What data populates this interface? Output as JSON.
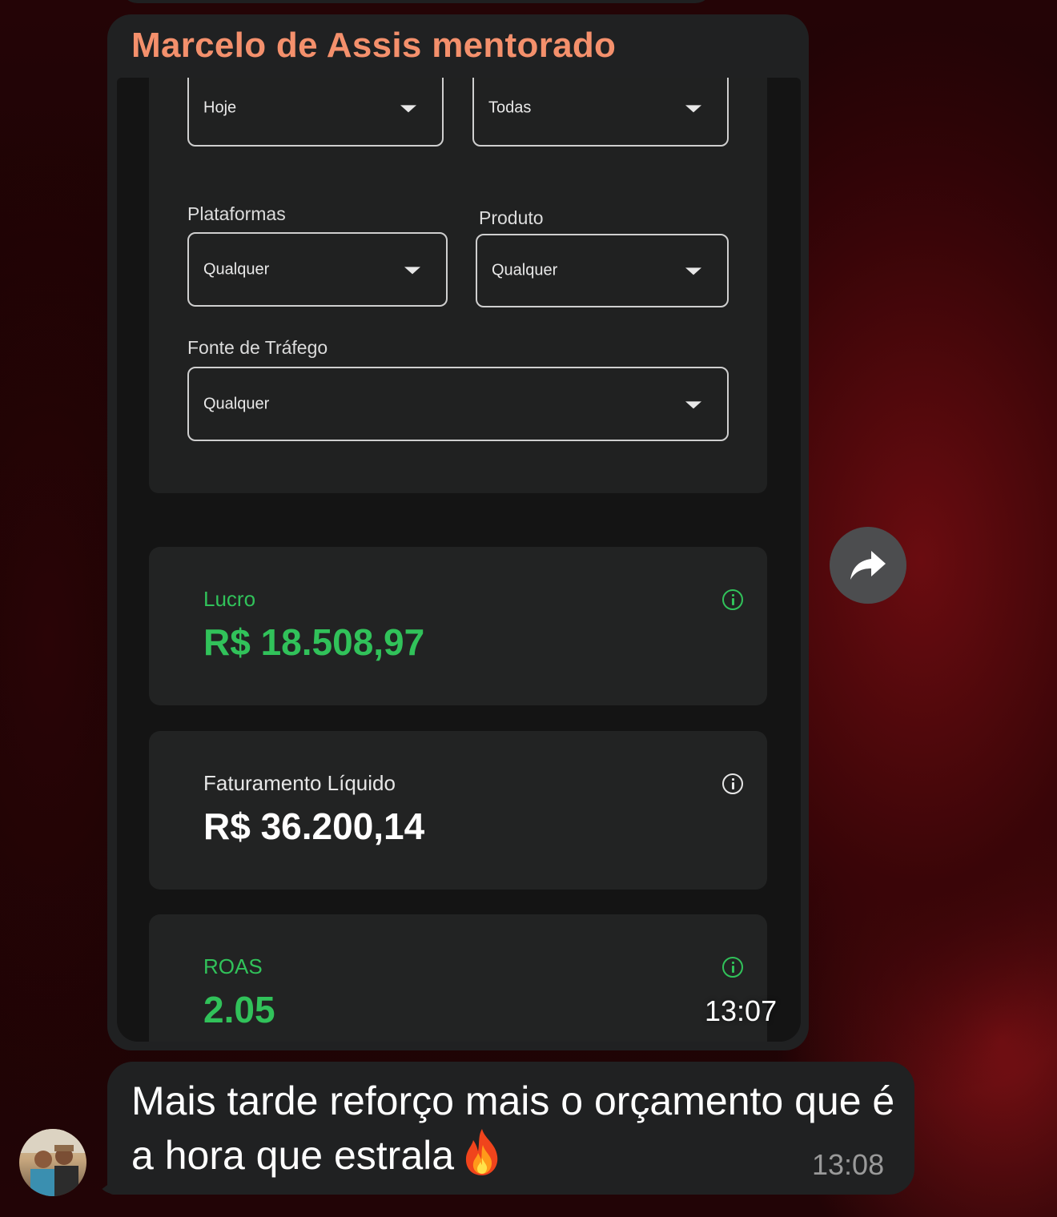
{
  "colors": {
    "sender_name": "#f4906c",
    "accent_green": "#31c25a",
    "bubble_bg": "#202122",
    "card_bg": "#222323"
  },
  "message_1": {
    "sender": "Marcelo de Assis mentorado",
    "time": "13:07",
    "screenshot": {
      "filters": {
        "period": {
          "value": "Hoje"
        },
        "accounts": {
          "value": "Todas"
        },
        "platforms": {
          "label": "Plataformas",
          "value": "Qualquer"
        },
        "product": {
          "label": "Produto",
          "value": "Qualquer"
        },
        "traffic_source": {
          "label": "Fonte de Tráfego",
          "value": "Qualquer"
        }
      },
      "cards": {
        "profit": {
          "label": "Lucro",
          "value": "R$ 18.508,97",
          "icon": "info-icon"
        },
        "net_revenue": {
          "label": "Faturamento Líquido",
          "value": "R$ 36.200,14",
          "icon": "info-icon"
        },
        "roas": {
          "label": "ROAS",
          "value": "2.05",
          "icon": "info-icon"
        }
      }
    }
  },
  "message_2": {
    "text": "Mais tarde reforço mais o orçamento que é a hora que estrala",
    "emoji": "fire-icon",
    "time": "13:08"
  },
  "actions": {
    "share_icon": "share-arrow-icon"
  }
}
